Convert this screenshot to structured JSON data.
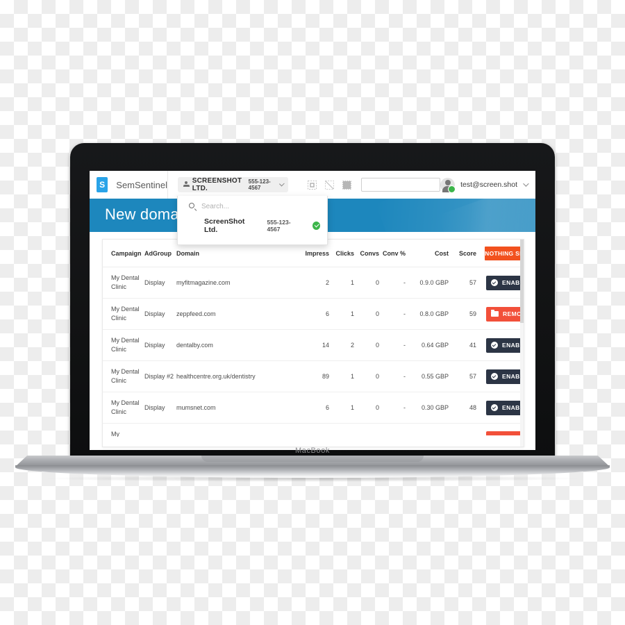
{
  "device": {
    "label": "MacBook"
  },
  "topbar": {
    "brand_initial": "S",
    "brand_name": "SemSentinel",
    "account_chip": {
      "name": "SCREENSHOT LTD.",
      "phone": "555-123-4567",
      "person_icon": "person-icon",
      "caret_icon": "chevron-down-icon"
    },
    "tool_icons": [
      "select-frame-icon",
      "no-image-icon",
      "grid-fill-icon"
    ],
    "search_field_value": "",
    "search_field_placeholder": "",
    "user": {
      "email": "test@screen.shot",
      "avatar_icon": "avatar-icon",
      "status_icon": "online-badge-icon",
      "caret_icon": "chevron-down-icon"
    }
  },
  "banner": {
    "title": "New domains",
    "color": "#1d87bd"
  },
  "account_panel": {
    "search_icon": "search-icon",
    "search_placeholder": "Search...",
    "rows": [
      {
        "name": "ScreenShot Ltd.",
        "phone": "555-123-4567",
        "selected_icon": "check-circle-icon"
      }
    ]
  },
  "table": {
    "columns": [
      "Campaign",
      "AdGroup",
      "Domain",
      "Impress",
      "Clicks",
      "Convs",
      "Conv %",
      "Cost",
      "Score"
    ],
    "bulk_action": {
      "label": "NOTHING SELECTED",
      "color": "#f2511e",
      "caret_icon": "chevron-down-icon"
    },
    "rows": [
      {
        "campaign": "My Dental Clinic",
        "adgroup": "Display",
        "domain": "myfitmagazine.com",
        "impress": "2",
        "clicks": "1",
        "convs": "0",
        "conv_pct": "-",
        "cost": "0.9.0 GBP",
        "score": "57",
        "status": {
          "label": "ENABLED",
          "kind": "enabled",
          "icon": "check-circle-icon",
          "caret_icon": "chevron-down-icon"
        }
      },
      {
        "campaign": "My Dental Clinic",
        "adgroup": "Display",
        "domain": "zeppfeed.com",
        "impress": "6",
        "clicks": "1",
        "convs": "0",
        "conv_pct": "-",
        "cost": "0.8.0 GBP",
        "score": "59",
        "status": {
          "label": "REMOVED",
          "kind": "removed",
          "icon": "folder-icon",
          "caret_icon": "chevron-down-icon"
        }
      },
      {
        "campaign": "My Dental Clinic",
        "adgroup": "Display",
        "domain": "dentalby.com",
        "impress": "14",
        "clicks": "2",
        "convs": "0",
        "conv_pct": "-",
        "cost": "0.64 GBP",
        "score": "41",
        "status": {
          "label": "ENABLED",
          "kind": "enabled",
          "icon": "check-circle-icon",
          "caret_icon": "chevron-down-icon"
        }
      },
      {
        "campaign": "My Dental Clinic",
        "adgroup": "Display #2",
        "domain": "healthcentre.org.uk/dentistry",
        "impress": "89",
        "clicks": "1",
        "convs": "0",
        "conv_pct": "-",
        "cost": "0.55 GBP",
        "score": "57",
        "status": {
          "label": "ENABLED",
          "kind": "enabled",
          "icon": "check-circle-icon",
          "caret_icon": "chevron-down-icon"
        }
      },
      {
        "campaign": "My Dental Clinic",
        "adgroup": "Display",
        "domain": "mumsnet.com",
        "impress": "6",
        "clicks": "1",
        "convs": "0",
        "conv_pct": "-",
        "cost": "0.30 GBP",
        "score": "48",
        "status": {
          "label": "ENABLED",
          "kind": "enabled",
          "icon": "check-circle-icon",
          "caret_icon": "chevron-down-icon"
        }
      }
    ],
    "partial_row": {
      "campaign": "My"
    }
  }
}
